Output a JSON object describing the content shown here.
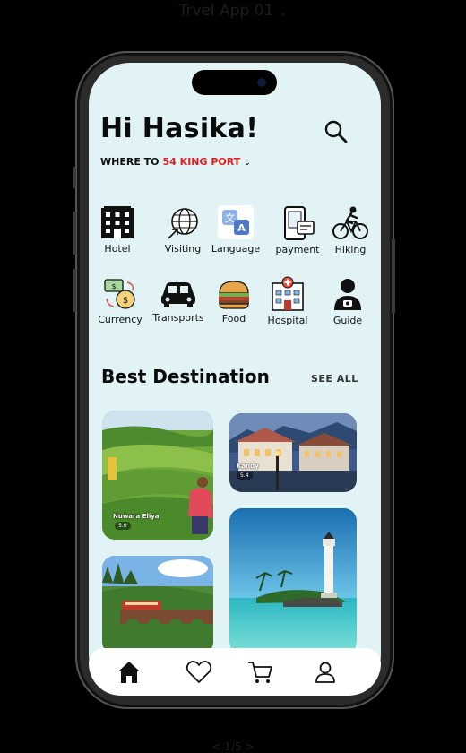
{
  "frame": {
    "title": "Trvel App 01",
    "pager": "< 1/5 >"
  },
  "header": {
    "greeting": "Hi Hasika!",
    "where_label": "WHERE TO",
    "location": "54 KING PORT"
  },
  "categories": [
    {
      "label": "Hotel",
      "icon": "hotel-icon"
    },
    {
      "label": "Visiting",
      "icon": "globe-icon"
    },
    {
      "label": "Language",
      "icon": "translate-icon"
    },
    {
      "label": "payment",
      "icon": "payment-icon"
    },
    {
      "label": "Hiking",
      "icon": "bicycle-icon"
    },
    {
      "label": "Currency",
      "icon": "currency-icon"
    },
    {
      "label": "Transports",
      "icon": "car-icon"
    },
    {
      "label": "Food",
      "icon": "burger-icon"
    },
    {
      "label": "Hospital",
      "icon": "hospital-icon"
    },
    {
      "label": "Guide",
      "icon": "guide-icon"
    }
  ],
  "destinations": {
    "title": "Best Destination",
    "see_all": "SEE ALL",
    "cards": [
      {
        "name": "Nuwara Eliya",
        "rating": "5.0"
      },
      {
        "name": "Kandy",
        "rating": "5.4"
      },
      {
        "name": "",
        "rating": ""
      },
      {
        "name": "",
        "rating": ""
      }
    ]
  },
  "tabbar": {
    "items": [
      "home-icon",
      "heart-icon",
      "cart-icon",
      "user-icon"
    ],
    "active": "home-icon"
  },
  "colors": {
    "screen_bg": "#e2f3f6",
    "accent": "#e01e1e",
    "text": "#0b0b0b"
  }
}
